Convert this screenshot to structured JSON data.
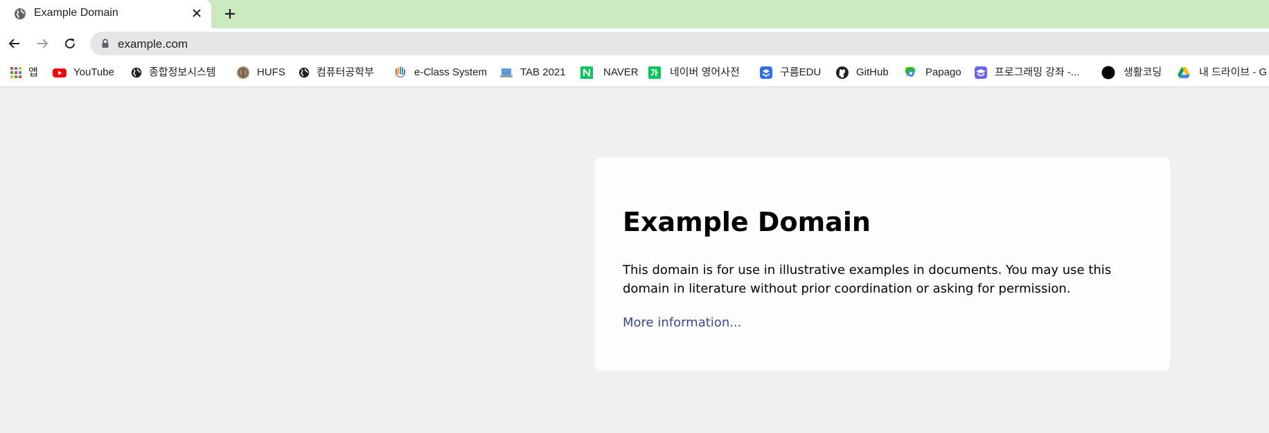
{
  "browser": {
    "tab": {
      "title": "Example Domain",
      "favicon_icon": "globe-icon",
      "close_icon": "close-icon"
    },
    "new_tab_icon": "plus-icon",
    "toolbar": {
      "back_icon": "arrow-left-icon",
      "forward_icon": "arrow-right-icon",
      "reload_icon": "reload-icon",
      "lock_icon": "lock-icon",
      "url": "example.com"
    },
    "bookmarks": [
      {
        "label": "앱",
        "icon": "apps-grid-icon"
      },
      {
        "label": "YouTube",
        "icon": "youtube-icon"
      },
      {
        "label": "종합정보시스템",
        "icon": "globe-icon"
      },
      {
        "label": "HUFS",
        "icon": "hufs-logo-icon"
      },
      {
        "label": "컴퓨터공학부",
        "icon": "globe-icon"
      },
      {
        "label": "e-Class System",
        "icon": "hand-logo-icon"
      },
      {
        "label": "TAB 2021",
        "icon": "laptop-icon"
      },
      {
        "label": "NAVER",
        "icon": "naver-icon"
      },
      {
        "label": "네이버 영어사전",
        "icon": "naver-dictionary-icon"
      },
      {
        "label": "구름EDU",
        "icon": "goorm-icon"
      },
      {
        "label": "GitHub",
        "icon": "github-icon"
      },
      {
        "label": "Papago",
        "icon": "papago-icon"
      },
      {
        "label": "프로그래밍 강좌 -...",
        "icon": "graduation-cap-icon"
      },
      {
        "label": "생활코딩",
        "icon": "black-circle-icon"
      },
      {
        "label": "내 드라이브 - G",
        "icon": "google-drive-icon"
      }
    ],
    "colors": {
      "tabstrip": "#cbeac0",
      "page_background": "#f0f0f2",
      "card_background": "#fdfdff",
      "link": "#38488f"
    }
  },
  "page": {
    "heading": "Example Domain",
    "paragraph": "This domain is for use in illustrative examples in documents. You may use this domain in literature without prior coordination or asking for permission.",
    "link_text": "More information..."
  }
}
